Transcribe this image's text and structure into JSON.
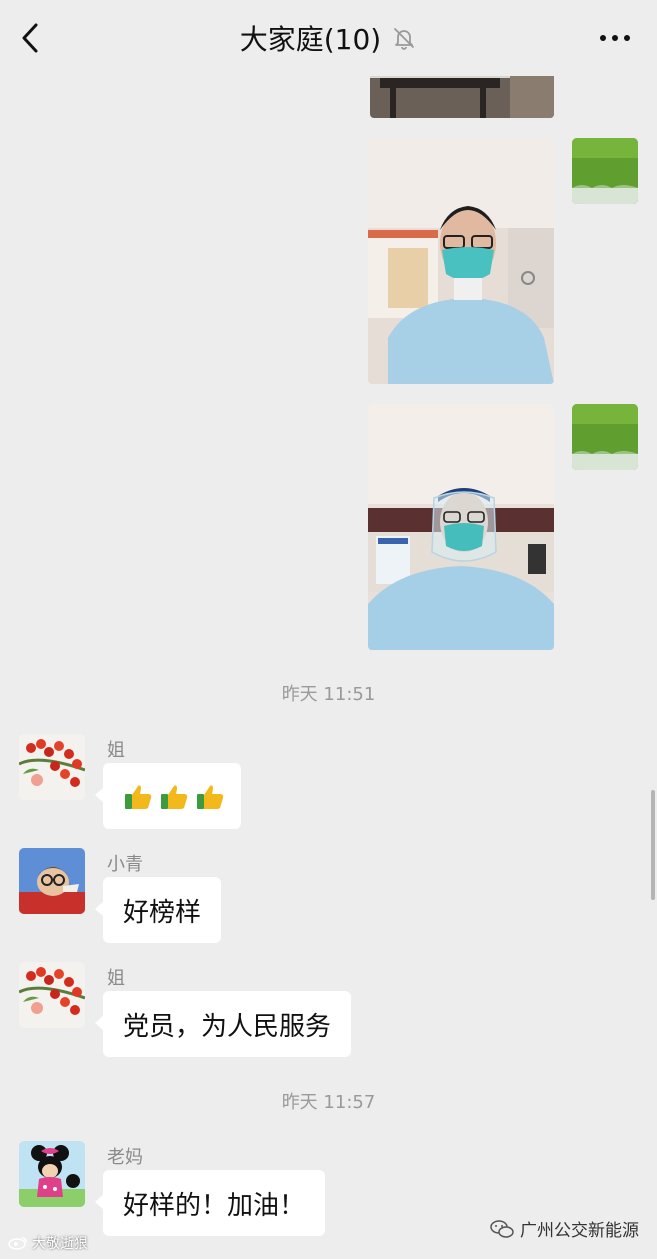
{
  "header": {
    "title": "大家庭(10)",
    "back_icon": "chevron-left-icon",
    "mute_icon": "bell-off-icon",
    "more_icon": "more-dots-icon"
  },
  "messages": {
    "timestamp_1": "昨天 11:51",
    "timestamp_2": "昨天 11:57",
    "msg_1": {
      "sender": "姐",
      "emoji": [
        "👍",
        "👍",
        "👍"
      ]
    },
    "msg_2": {
      "sender": "小青",
      "text": "好榜样"
    },
    "msg_3": {
      "sender": "姐",
      "text": "党员，为人民服务"
    },
    "msg_4": {
      "sender": "老妈",
      "text": "好样的！加油！"
    }
  },
  "watermarks": {
    "left": "大敬逝狠",
    "right": "广州公交新能源"
  },
  "colors": {
    "background": "#ededed",
    "bubble": "#ffffff",
    "timestamp_text": "#9a9a9a"
  }
}
